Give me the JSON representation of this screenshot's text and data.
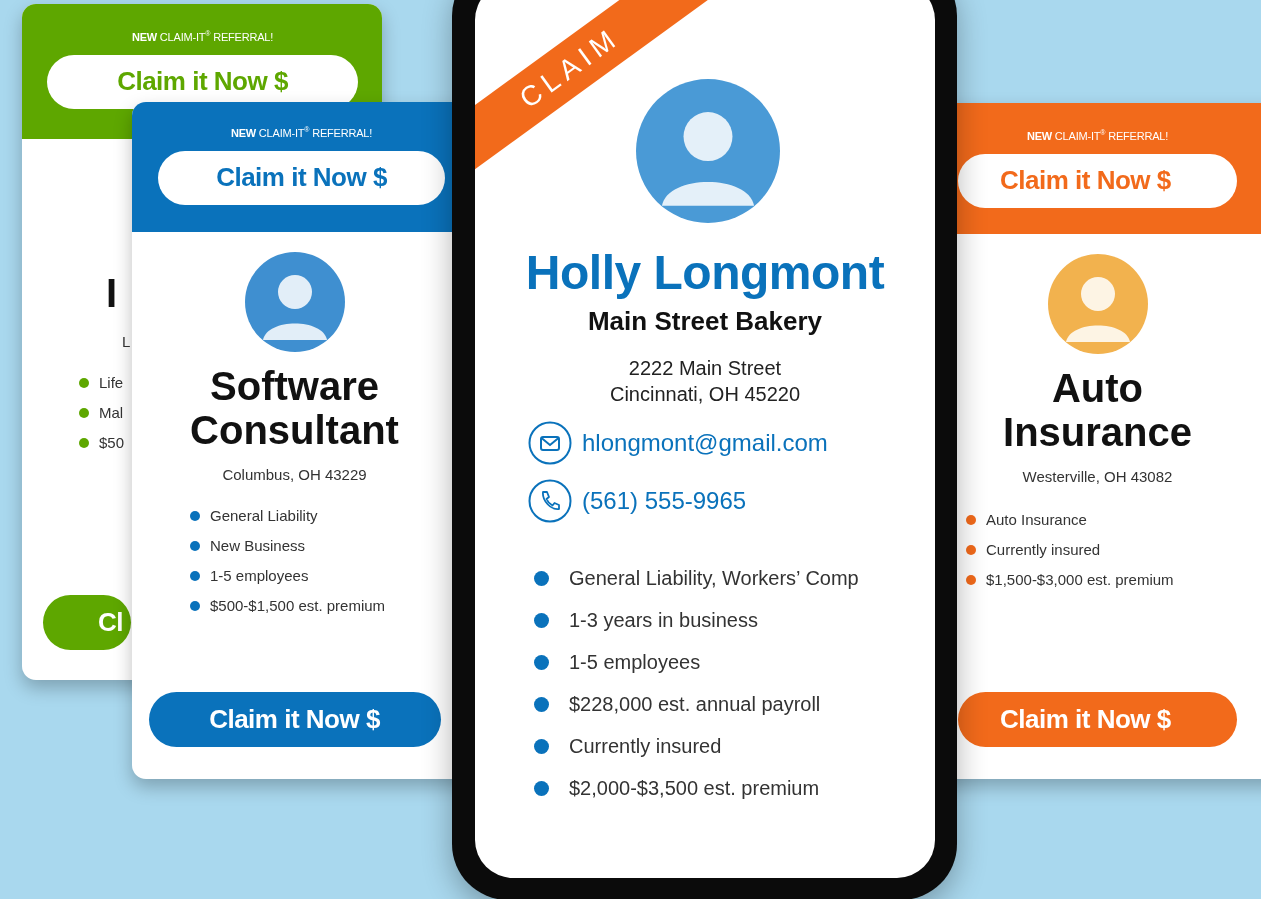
{
  "cards": [
    {
      "color": "#5ea700",
      "banner": "**NEW** CLAIM-IT$^{®}$ REFERRAL!",
      "top_button": "Claim it Now $",
      "title": "I",
      "location": "L",
      "bullets": [
        "Life",
        "Mal",
        "$50"
      ],
      "bottom_button": "Cl"
    },
    {
      "color": "#0a72bb",
      "banner": "**NEW** CLAIM-IT$^{®}$ REFERRAL!",
      "top_button": "Claim it Now $",
      "title": "Software Consultant",
      "location": "Columbus, OH 43229",
      "bullets": [
        "General Liability",
        "New Business",
        "1-5 employees",
        "$500-$1,500 est. premium"
      ],
      "bottom_button": "Claim it Now $"
    },
    {
      "color": "#f26a1b",
      "banner": "**NEW** CLAIM-IT$^{®}$ REFERRAL!",
      "top_button": "Claim it Now $",
      "title": "Auto Insurance",
      "location": "Westerville, OH 43082",
      "bullets": [
        "Auto Insurance",
        "Currently insured",
        "$1,500-$3,000 est. premium"
      ],
      "bottom_button": "Claim it Now $"
    }
  ],
  "phone": {
    "ribbon": "CLAIM",
    "name": "Holly Longmont",
    "business": "Main Street Bakery",
    "address": [
      "2222 Main Street",
      "Cincinnati, OH 45220"
    ],
    "email": "hlongmont@gmail.com",
    "phone": "(561) 555-9965",
    "bullets": [
      "General Liability, Workers’ Comp",
      "1-3 years in business",
      "1-5 employees",
      "$228,000 est. annual payroll",
      "Currently insured",
      "$2,000-$3,500 est. premium"
    ]
  }
}
